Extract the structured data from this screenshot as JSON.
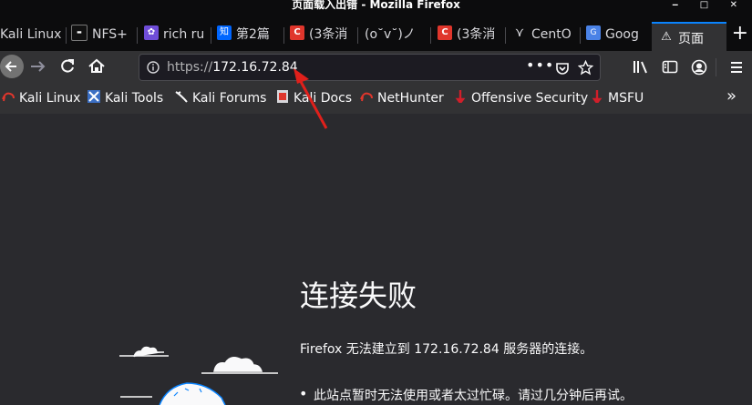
{
  "window": {
    "title": "页面载入出错 - Mozilla Firefox",
    "controls": "‒ □ ✕"
  },
  "tabs": [
    {
      "label": "Kali Linux",
      "icon": "kali-icon"
    },
    {
      "label": "NFS+",
      "icon": "nfs-icon"
    },
    {
      "label": "rich ru",
      "icon": "baidu-icon"
    },
    {
      "label": "第2篇",
      "icon": "zhihu-icon"
    },
    {
      "label": "(3条消",
      "icon": "csdn-icon"
    },
    {
      "label": "(o˘v˘)ノ",
      "icon": ""
    },
    {
      "label": "(3条消",
      "icon": "csdn-icon"
    },
    {
      "label": "CentO",
      "icon": "centos-icon"
    },
    {
      "label": "Goog",
      "icon": "google-translate-icon"
    },
    {
      "label": "页面",
      "icon": "warning-icon",
      "active": true
    }
  ],
  "newtab_label": "+",
  "url": {
    "scheme": "https://",
    "host": "172.16.72.84"
  },
  "bookmarks": [
    {
      "label": "Kali Linux"
    },
    {
      "label": "Kali Tools"
    },
    {
      "label": "Kali Forums"
    },
    {
      "label": "Kali Docs"
    },
    {
      "label": "NetHunter"
    },
    {
      "label": "Offensive Security"
    },
    {
      "label": "MSFU"
    }
  ],
  "error": {
    "title": "连接失败",
    "description": "Firefox 无法建立到 172.16.72.84 服务器的连接。",
    "bullets": [
      "此站点暂时无法使用或者太过忙碌。请过几分钟后再试。"
    ]
  },
  "colors": {
    "accent": "#0a84ff",
    "annotation_arrow": "#e0201b",
    "background": "#2a2a2e"
  }
}
